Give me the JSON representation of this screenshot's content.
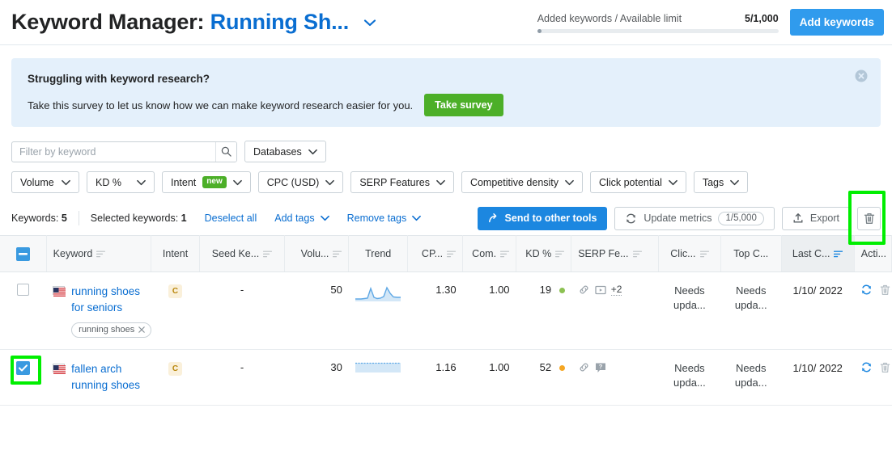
{
  "header": {
    "title_prefix": "Keyword Manager: ",
    "project_name": "Running Sh...",
    "chevron_icon": "chevron-down-icon",
    "limit_label": "Added keywords / Available limit",
    "limit_value": "5/1,000",
    "add_keywords_label": "Add keywords",
    "accent_blue": "#309bed"
  },
  "banner": {
    "title": "Struggling with keyword research?",
    "text": "Take this survey to let us know how we can make keyword research easier for you.",
    "button_label": "Take survey",
    "close_icon": "close-circle-icon",
    "bg": "#e4f0fb",
    "button_color": "#4caf28"
  },
  "filters": {
    "search_placeholder": "Filter by keyword",
    "search_value": "",
    "search_icon": "search-icon",
    "databases_label": "Databases",
    "pills": [
      {
        "label": "Volume",
        "badge": ""
      },
      {
        "label": "KD %",
        "badge": ""
      },
      {
        "label": "Intent",
        "badge": "new"
      },
      {
        "label": "CPC (USD)",
        "badge": ""
      },
      {
        "label": "SERP Features",
        "badge": ""
      },
      {
        "label": "Competitive density",
        "badge": ""
      },
      {
        "label": "Click potential",
        "badge": ""
      },
      {
        "label": "Tags",
        "badge": ""
      }
    ]
  },
  "actionbar": {
    "keywords_label": "Keywords:",
    "keywords_count": "5",
    "selected_label": "Selected keywords:",
    "selected_count": "1",
    "deselect_all": "Deselect all",
    "add_tags": "Add tags",
    "remove_tags": "Remove tags",
    "send_to_other_tools": "Send to other tools",
    "update_metrics": "Update metrics",
    "update_metrics_counter": "1/5,000",
    "export": "Export",
    "delete_icon": "trash-icon",
    "highlight_color": "#00ee00"
  },
  "table": {
    "select_all_state": "indeterminate",
    "columns": [
      {
        "label": "Keyword",
        "sortable": true,
        "sorted": false,
        "align": "left"
      },
      {
        "label": "Intent",
        "sortable": false,
        "sorted": false,
        "align": "center"
      },
      {
        "label": "Seed Ke...",
        "sortable": true,
        "sorted": false,
        "align": "center"
      },
      {
        "label": "Volu...",
        "sortable": true,
        "sorted": false,
        "align": "right"
      },
      {
        "label": "Trend",
        "sortable": false,
        "sorted": false,
        "align": "center"
      },
      {
        "label": "CP...",
        "sortable": true,
        "sorted": false,
        "align": "right"
      },
      {
        "label": "Com.",
        "sortable": true,
        "sorted": false,
        "align": "right"
      },
      {
        "label": "KD %",
        "sortable": true,
        "sorted": false,
        "align": "right"
      },
      {
        "label": "SERP Fe...",
        "sortable": true,
        "sorted": false,
        "align": "left"
      },
      {
        "label": "Clic...",
        "sortable": true,
        "sorted": false,
        "align": "center"
      },
      {
        "label": "Top C...",
        "sortable": false,
        "sorted": false,
        "align": "center"
      },
      {
        "label": "Last C...",
        "sortable": true,
        "sorted": true,
        "align": "center"
      },
      {
        "label": "Acti...",
        "sortable": false,
        "sorted": false,
        "align": "left"
      }
    ],
    "rows": [
      {
        "checked": false,
        "highlight_checkbox": false,
        "flag": "us-flag-icon",
        "keyword": "running shoes for seniors",
        "tags": [
          "running shoes"
        ],
        "intent": "C",
        "seed_keyword": "-",
        "volume": "50",
        "trend_type": "peaks",
        "cpc": "1.30",
        "competition": "1.00",
        "kd": "19",
        "kd_color": "#8cc152",
        "serp_features": [
          "link-icon",
          "video-icon"
        ],
        "serp_more": "+2",
        "click_potential": "Needs upda...",
        "top_competitor": "Needs upda...",
        "last_checked": "1/10/ 2022",
        "actions": [
          "refresh-icon",
          "trash-icon"
        ]
      },
      {
        "checked": true,
        "highlight_checkbox": true,
        "flag": "us-flag-icon",
        "keyword": "fallen arch running shoes",
        "tags": [],
        "intent": "C",
        "seed_keyword": "-",
        "volume": "30",
        "trend_type": "flat",
        "cpc": "1.16",
        "competition": "1.00",
        "kd": "52",
        "kd_color": "#f5a623",
        "serp_features": [
          "link-icon",
          "faq-icon"
        ],
        "serp_more": "",
        "click_potential": "Needs upda...",
        "top_competitor": "Needs upda...",
        "last_checked": "1/10/ 2022",
        "actions": [
          "refresh-icon",
          "trash-icon"
        ]
      }
    ]
  }
}
